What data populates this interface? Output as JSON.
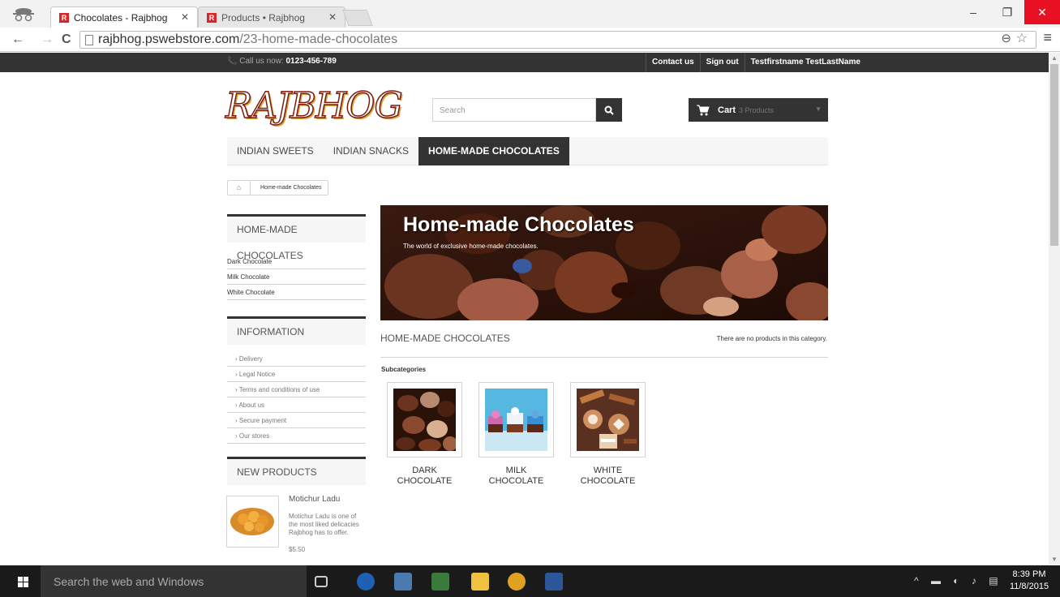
{
  "browser": {
    "tabs": [
      {
        "title": "Chocolates - Rajbhog",
        "favicon": "R"
      },
      {
        "title": "Products • Rajbhog",
        "favicon": "R"
      }
    ],
    "url_host": "rajbhog.pswebstore.com",
    "url_path": "/23-home-made-chocolates"
  },
  "topbar": {
    "phone_label": "Call us now:",
    "phone_number": "0123-456-789",
    "links": [
      "Contact us",
      "Sign out",
      "Testfirstname TestLastName"
    ]
  },
  "header": {
    "logo": "RAJBHOG",
    "search_placeholder": "Search",
    "cart_label": "Cart",
    "cart_qty": "3 Products"
  },
  "menu": [
    "INDIAN SWEETS",
    "INDIAN SNACKS",
    "HOME-MADE CHOCOLATES"
  ],
  "breadcrumb": "Home-made Chocolates",
  "sidebar": {
    "categories_title": "HOME-MADE CHOCOLATES",
    "categories": [
      "Dark Chocolate",
      "Milk Chocolate",
      "White Chocolate"
    ],
    "info_title": "INFORMATION",
    "info_links": [
      "Delivery",
      "Legal Notice",
      "Terms and conditions of use",
      "About us",
      "Secure payment",
      "Our stores"
    ],
    "new_title": "NEW PRODUCTS",
    "new_product": {
      "name": "Motichur Ladu",
      "desc": "Motichur Ladu is one of the most liked delicacies Rajbhog has to offer.",
      "price": "$5.50"
    }
  },
  "main": {
    "banner_title": "Home-made Chocolates",
    "banner_subtitle": "The world of exclusive home-made chocolates.",
    "category_heading": "HOME-MADE CHOCOLATES",
    "no_products": "There are no products in this category.",
    "subcategories_label": "Subcategories",
    "subcategories": [
      {
        "line1": "DARK",
        "line2": "CHOCOLATE"
      },
      {
        "line1": "MILK",
        "line2": "CHOCOLATE"
      },
      {
        "line1": "WHITE",
        "line2": "CHOCOLATE"
      }
    ]
  },
  "taskbar": {
    "search_placeholder": "Search the web and Windows",
    "time": "8:39 PM",
    "date": "11/8/2015"
  },
  "colors": {
    "dark": "#333333",
    "accent_red": "#e81123",
    "favicon_red": "#d9262b"
  }
}
